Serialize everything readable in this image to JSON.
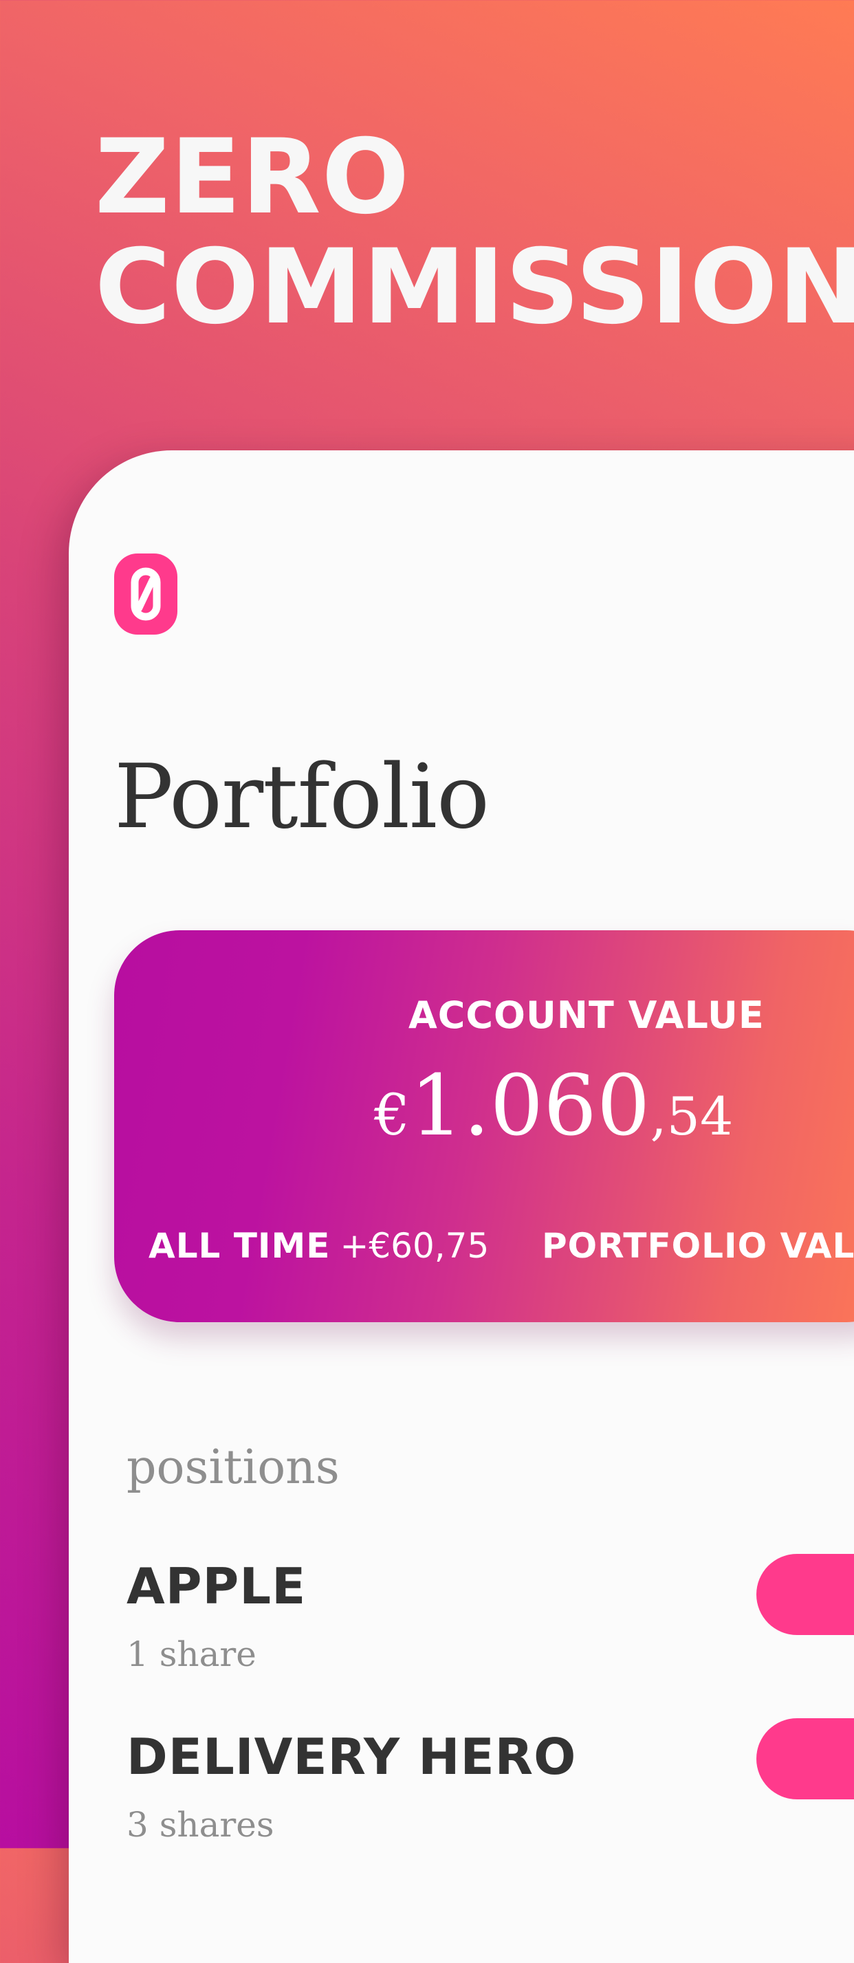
{
  "headline": {
    "line1": "ZERO",
    "line2": "COMMISSION"
  },
  "app": {
    "logo_icon": "zero-logo-icon",
    "page_title": "Portfolio"
  },
  "account_card": {
    "label": "ACCOUNT VALUE",
    "currency": "€",
    "value_main": "1.060",
    "value_cents": ",54",
    "all_time_label": "ALL TIME",
    "all_time_value": "+€60,75",
    "portfolio_value_label": "PORTFOLIO VALUE"
  },
  "positions": {
    "section_label": "positions",
    "items": [
      {
        "name": "APPLE",
        "shares": "1 share"
      },
      {
        "name": "DELIVERY HERO",
        "shares": "3 shares"
      }
    ]
  },
  "colors": {
    "accent_pink": "#ff3a8c",
    "gradient_orange": "#ff7b54",
    "gradient_magenta": "#b70ea0",
    "text_dark": "#333333",
    "text_muted": "#8e8e8e"
  }
}
